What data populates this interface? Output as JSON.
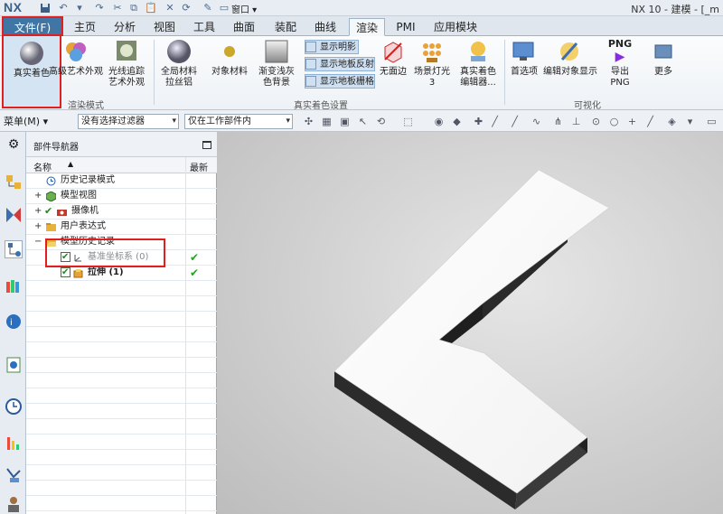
{
  "titlebar": {
    "logo": "NX",
    "window_menu": "窗口 ▾",
    "title": "NX 10 - 建模 - [_m"
  },
  "tabs": [
    {
      "label": "文件(F)",
      "active": false
    },
    {
      "label": "主页",
      "active": false
    },
    {
      "label": "分析",
      "active": false
    },
    {
      "label": "视图",
      "active": false
    },
    {
      "label": "工具",
      "active": false
    },
    {
      "label": "曲面",
      "active": false
    },
    {
      "label": "装配",
      "active": false
    },
    {
      "label": "曲线",
      "active": false
    },
    {
      "label": "渲染",
      "active": true
    },
    {
      "label": "PMI",
      "active": false
    },
    {
      "label": "应用模块",
      "active": false
    }
  ],
  "ribbon": {
    "realistic_shading": "真实着色",
    "advanced_art_line1": "高级艺术外观",
    "ray_trace_line1": "光线追踪",
    "ray_trace_line2": "艺术外观",
    "group_render_mode": "渲染模式",
    "global_material_line1": "全局材料",
    "global_material_line2": "拉丝铝",
    "object_material": "对象材料",
    "gradient_bg_line1": "渐变浅灰",
    "gradient_bg_line2": "色背景",
    "show_highlight": "显示明影",
    "show_floor_reflection": "显示地板反射",
    "show_floor_grid": "显示地板栅格",
    "no_edge": "无面边",
    "scene_light": "场景灯光 3",
    "realistic_editor_line1": "真实着色",
    "realistic_editor_line2": "编辑器...",
    "group_realistic_settings": "真实着色设置",
    "preferences": "首选项",
    "edit_object_display": "编辑对象显示",
    "export_png": "导出 PNG",
    "png_badge": "PNG",
    "more": "更多",
    "group_visualization": "可视化"
  },
  "filterbar": {
    "menu": "菜单(M) ▾",
    "filter": "没有选择过滤器",
    "scope": "仅在工作部件内"
  },
  "navigator": {
    "title": "部件导航器",
    "col_name": "名称",
    "col_latest": "最新",
    "rows": [
      {
        "label": "历史记录模式",
        "latest": ""
      },
      {
        "label": "模型视图",
        "latest": ""
      },
      {
        "label": "摄像机",
        "latest": ""
      },
      {
        "label": "用户表达式",
        "latest": ""
      },
      {
        "label": "模型历史记录",
        "latest": ""
      },
      {
        "label": "基准坐标系 (0)",
        "latest": "✔"
      },
      {
        "label": "拉伸 (1)",
        "latest": "✔"
      }
    ]
  },
  "colors": {
    "file_tab": "#3f76a6",
    "highlight_red": "#e02020",
    "latest_green": "#22a522"
  }
}
